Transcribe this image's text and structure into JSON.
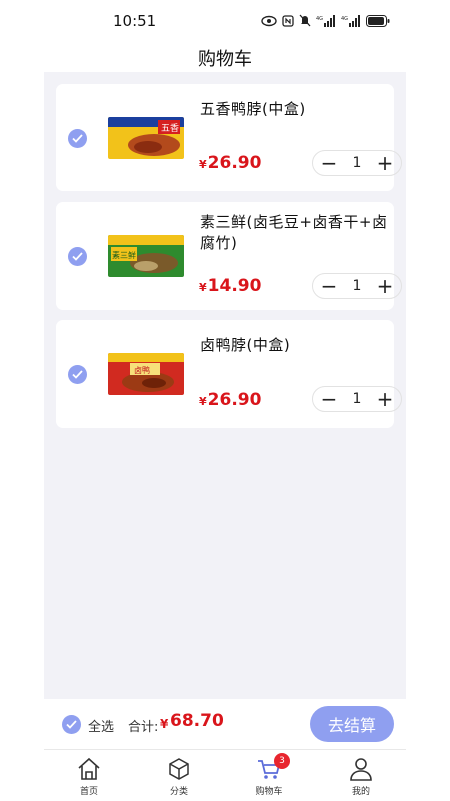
{
  "status_bar": {
    "time": "10:51",
    "network_label": "4G"
  },
  "header": {
    "title": "购物车"
  },
  "cart": {
    "items": [
      {
        "name": "五香鸭脖(中盒)",
        "currency": "¥",
        "price": "26.90",
        "quantity": "1",
        "checked": true,
        "box_text": "五香"
      },
      {
        "name": "素三鲜(卤毛豆+卤香干+卤腐竹)",
        "currency": "¥",
        "price": "14.90",
        "quantity": "1",
        "checked": true,
        "box_text": "素三鲜"
      },
      {
        "name": "卤鸭脖(中盒)",
        "currency": "¥",
        "price": "26.90",
        "quantity": "1",
        "checked": true,
        "box_text": "卤鸭"
      }
    ],
    "stepper": {
      "minus": "−",
      "plus": "+"
    }
  },
  "footer": {
    "select_all_label": "全选",
    "total_label": "合计:",
    "total_currency": "¥",
    "total_value": "68.70",
    "checkout_label": "去结算"
  },
  "tabbar": {
    "tabs": [
      {
        "label": "首页",
        "icon": "home-icon"
      },
      {
        "label": "分类",
        "icon": "category-box-icon"
      },
      {
        "label": "购物车",
        "icon": "cart-icon",
        "badge": "3",
        "active": true
      },
      {
        "label": "我的",
        "icon": "user-icon"
      }
    ]
  },
  "colors": {
    "accent": "#8f9ff0",
    "price": "#d9151b",
    "badge": "#e8252e",
    "background": "#f2f2f7"
  }
}
